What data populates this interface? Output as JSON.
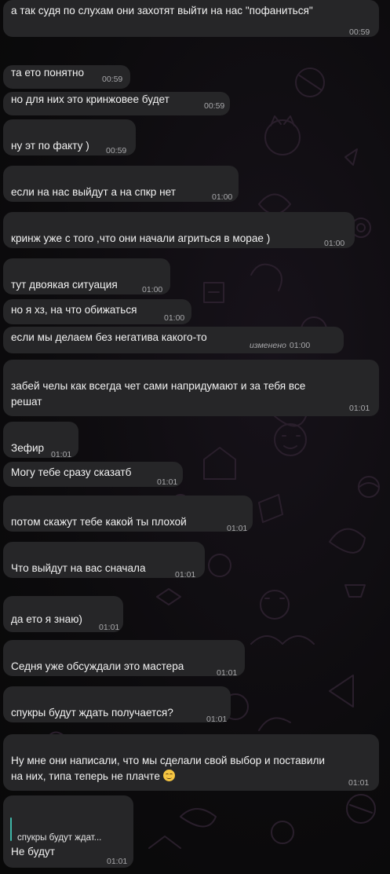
{
  "messages": [
    {
      "text": "а так судя по  слухам они захотят выйти на нас \"пофаниться\"",
      "time": "00:59"
    },
    {
      "text": "та ето понятно",
      "time": "00:59"
    },
    {
      "text": "но для них это кринжовее будет",
      "time": "00:59"
    },
    {
      "text": "ну эт по факту )",
      "time": "00:59"
    },
    {
      "text": "если на нас выйдут а на спкр нет",
      "time": "01:00"
    },
    {
      "text": "кринж уже с того ,что они начали агриться в морае )",
      "time": "01:00"
    },
    {
      "text": "тут двоякая ситуация",
      "time": "01:00"
    },
    {
      "text": "но я хз, на что обижаться",
      "time": "01:00"
    },
    {
      "text": "если мы делаем без негатива какого-то",
      "time": "01:00",
      "edited_label": "изменено"
    },
    {
      "text": "забей челы как всегда чет сами напридумают и за тебя все решат",
      "time": "01:01"
    },
    {
      "text": "Зефир",
      "time": "01:01"
    },
    {
      "text": "Могу тебе сразу сказатб",
      "time": "01:01"
    },
    {
      "text": "потом скажут тебе какой ты плохой",
      "time": "01:01"
    },
    {
      "text": "Что выйдут на вас сначала",
      "time": "01:01"
    },
    {
      "text": "да ето я знаю)",
      "time": "01:01"
    },
    {
      "text": "Седня уже обсуждали это мастера",
      "time": "01:01"
    },
    {
      "text": "спукры будут ждать получается?",
      "time": "01:01"
    },
    {
      "text": "Ну мне они написали, что мы сделали свой выбор и поставили на них, типа теперь не плачте",
      "time": "01:01",
      "emoji": "smiling-face-emoji"
    },
    {
      "text": "Не будут",
      "time": "01:01",
      "reply_to": "спукры будут ждат..."
    }
  ],
  "colors": {
    "background": "#0b0b0c",
    "bubble": "#262628",
    "text": "#f2f2f2",
    "time": "#a8a8ab",
    "reply_accent": "#3fb6a8"
  }
}
